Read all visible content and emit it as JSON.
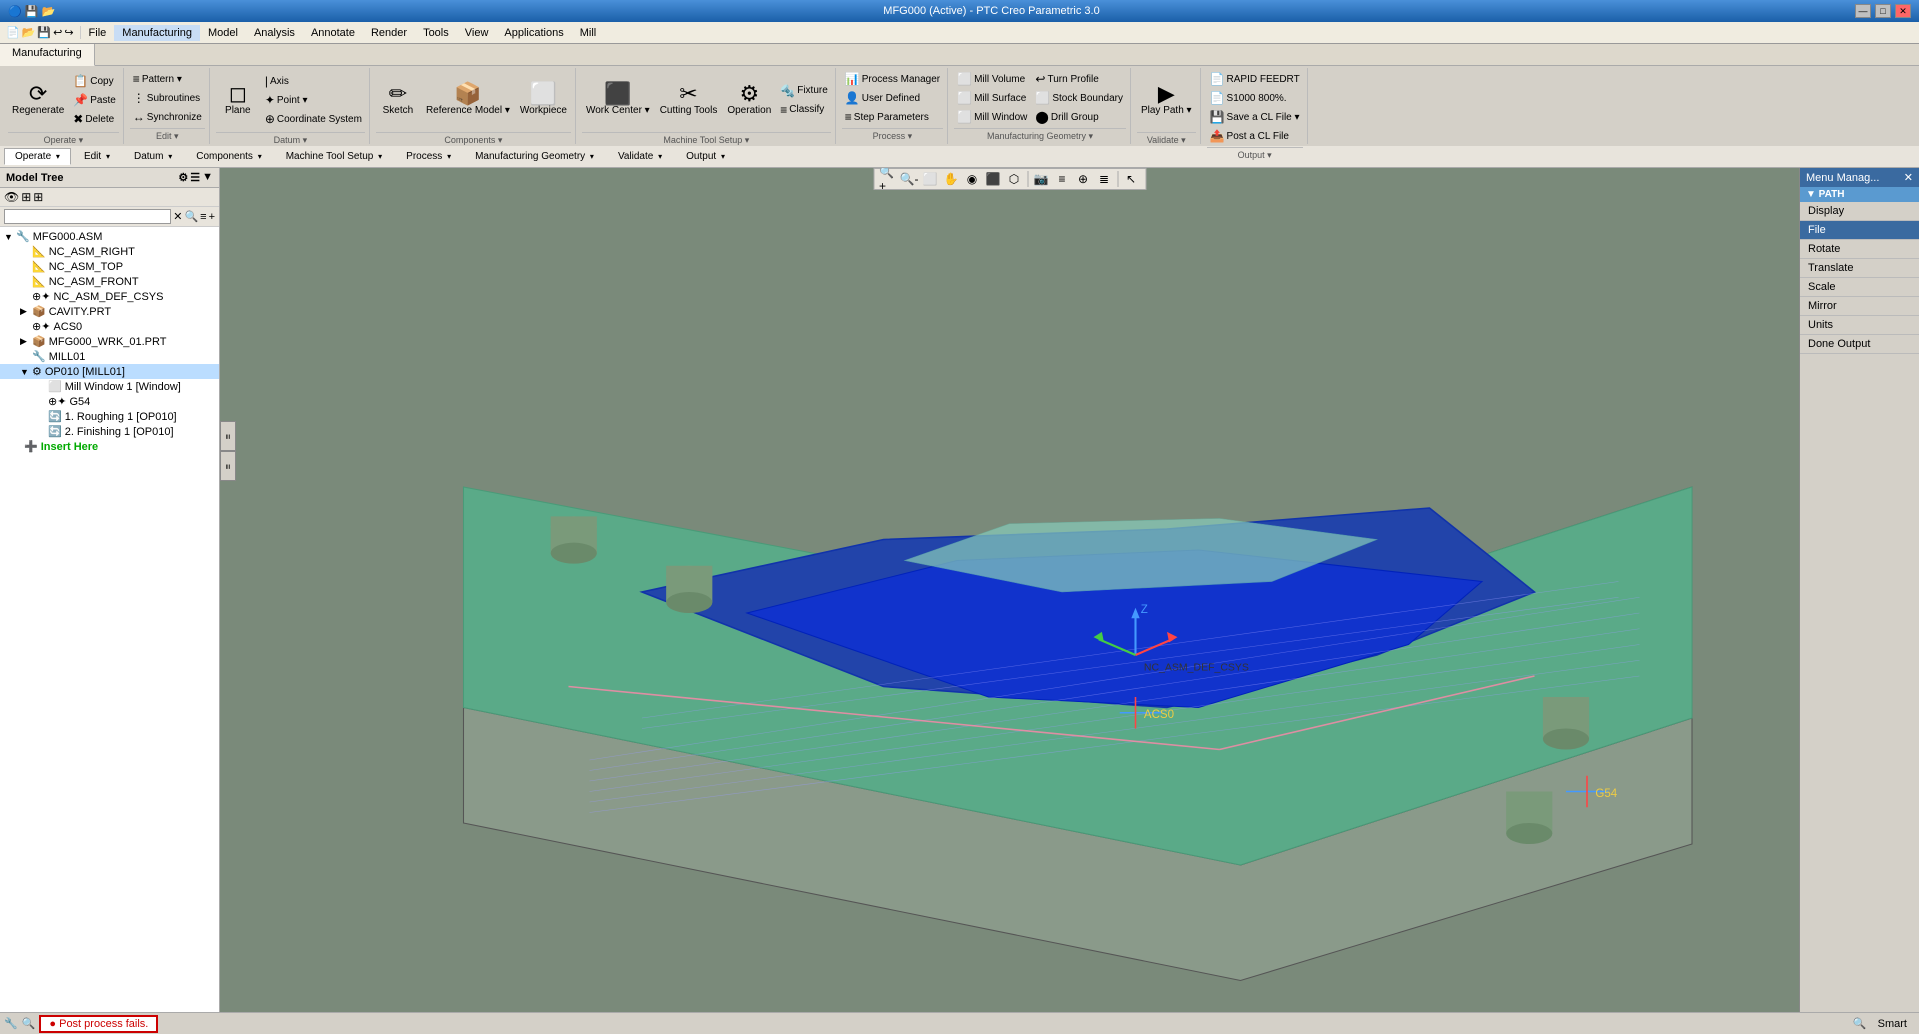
{
  "title": "MFG000 (Active) - PTC Creo Parametric 3.0",
  "titlebar": {
    "controls": [
      "—",
      "□",
      "✕"
    ]
  },
  "menubar": {
    "items": [
      "File",
      "Manufacturing",
      "Model",
      "Analysis",
      "Annotate",
      "Render",
      "Tools",
      "View",
      "Applications",
      "Mill"
    ]
  },
  "ribbon": {
    "tabs": [
      "Manufacturing"
    ],
    "groups": [
      {
        "label": "Operate",
        "buttons_large": [
          {
            "icon": "⟳",
            "label": "Regenerate"
          }
        ],
        "buttons_small": [
          {
            "icon": "📋",
            "label": "Copy"
          },
          {
            "icon": "📌",
            "label": "Paste"
          },
          {
            "icon": "🗑",
            "label": "Delete"
          }
        ]
      },
      {
        "label": "Edit",
        "buttons_small": [
          {
            "icon": "≡",
            "label": "Pattern ▾"
          },
          {
            "icon": "⋮",
            "label": "Subroutines"
          },
          {
            "icon": "≡",
            "label": "Synchronize"
          }
        ]
      },
      {
        "label": "Datum",
        "buttons_large": [
          {
            "icon": "◉",
            "label": "Plane"
          }
        ],
        "buttons_small": [
          {
            "icon": "•",
            "label": "Axis"
          },
          {
            "icon": "✦",
            "label": "Point ▾"
          },
          {
            "icon": "⊕",
            "label": "Coordinate System"
          }
        ]
      },
      {
        "label": "Components",
        "buttons_large": [
          {
            "icon": "✏",
            "label": "Sketch"
          },
          {
            "icon": "⬡",
            "label": "Reference Model ▾"
          },
          {
            "icon": "⚙",
            "label": "Workpiece"
          }
        ]
      },
      {
        "label": "Machine Tool Setup",
        "buttons_large": [
          {
            "icon": "⬜",
            "label": "Work Center ▾"
          },
          {
            "icon": "✂",
            "label": "Cutting Tools"
          },
          {
            "icon": "⚙",
            "label": "Operation"
          }
        ],
        "buttons_small": [
          {
            "icon": "🔧",
            "label": "Fixture"
          },
          {
            "icon": "≡",
            "label": "Classify"
          }
        ]
      },
      {
        "label": "Process",
        "buttons_small": [
          {
            "icon": "⚙",
            "label": "Process Manager"
          },
          {
            "icon": "👤",
            "label": "User Defined"
          },
          {
            "icon": "≡",
            "label": "Step Parameters"
          }
        ]
      },
      {
        "label": "Manufacturing Geometry",
        "buttons_small": [
          {
            "icon": "⬜",
            "label": "Mill Volume"
          },
          {
            "icon": "⬜",
            "label": "Mill Surface"
          },
          {
            "icon": "⬜",
            "label": "Mill Window"
          },
          {
            "icon": "↩",
            "label": "Turn Profile"
          },
          {
            "icon": "⬜",
            "label": "Stock Boundary"
          },
          {
            "icon": "⬤",
            "label": "Drill Group"
          }
        ]
      },
      {
        "label": "Validate",
        "buttons_small": [
          {
            "icon": "▶",
            "label": "Play Path ▾"
          }
        ]
      },
      {
        "label": "Output",
        "buttons_small": [
          {
            "icon": "📄",
            "label": "RAPID FEEDRT"
          },
          {
            "icon": "📄",
            "label": "S1000 800%."
          },
          {
            "icon": "💾",
            "label": "Save a CL File ▾"
          },
          {
            "icon": "📄",
            "label": "Post a CL File"
          }
        ]
      }
    ]
  },
  "toolbar": {
    "buttons": [
      "🔍+",
      "🔍-",
      "⬜",
      "◻",
      "◉",
      "⬛",
      "⬡",
      "📷",
      "⊕",
      "✕",
      "⟳"
    ]
  },
  "cmd_tabs": [
    {
      "label": "Operate",
      "active": false
    },
    {
      "label": "Edit",
      "active": false
    },
    {
      "label": "Datum",
      "active": false
    },
    {
      "label": "Components",
      "active": false
    },
    {
      "label": "Machine Tool Setup",
      "active": false
    },
    {
      "label": "Process",
      "active": false
    },
    {
      "label": "Manufacturing Geometry",
      "active": false
    },
    {
      "label": "Validate",
      "active": false
    },
    {
      "label": "Output",
      "active": false
    }
  ],
  "model_tree": {
    "title": "Model Tree",
    "search_placeholder": "",
    "items": [
      {
        "indent": 0,
        "expand": "",
        "icon": "🔧",
        "text": "MFG000.ASM",
        "level": 0
      },
      {
        "indent": 1,
        "expand": "",
        "icon": "📐",
        "text": "NC_ASM_RIGHT",
        "level": 1
      },
      {
        "indent": 1,
        "expand": "",
        "icon": "📐",
        "text": "NC_ASM_TOP",
        "level": 1
      },
      {
        "indent": 1,
        "expand": "",
        "icon": "📐",
        "text": "NC_ASM_FRONT",
        "level": 1
      },
      {
        "indent": 1,
        "expand": "",
        "icon": "⊕",
        "text": "NC_ASM_DEF_CSYS",
        "level": 1
      },
      {
        "indent": 1,
        "expand": "▶",
        "icon": "📦",
        "text": "CAVITY.PRT",
        "level": 1
      },
      {
        "indent": 1,
        "expand": "",
        "icon": "⊕",
        "text": "ACS0",
        "level": 1
      },
      {
        "indent": 1,
        "expand": "▶",
        "icon": "📦",
        "text": "MFG000_WRK_01.PRT",
        "level": 1
      },
      {
        "indent": 1,
        "expand": "",
        "icon": "🔧",
        "text": "MILL01",
        "level": 1
      },
      {
        "indent": 1,
        "expand": "▼",
        "icon": "⚙",
        "text": "OP010 [MILL01]",
        "level": 1
      },
      {
        "indent": 2,
        "expand": "",
        "icon": "⬜",
        "text": "Mill Window 1 [Window]",
        "level": 2
      },
      {
        "indent": 2,
        "expand": "",
        "icon": "⊕",
        "text": "G54",
        "level": 2
      },
      {
        "indent": 2,
        "expand": "",
        "icon": "🔄",
        "text": "1. Roughing 1 [OP010]",
        "level": 2
      },
      {
        "indent": 2,
        "expand": "",
        "icon": "🔄",
        "text": "2. Finishing 1 [OP010]",
        "level": 2
      },
      {
        "indent": 1,
        "expand": "",
        "icon": "➕",
        "text": "Insert Here",
        "level": 1,
        "special": "insert"
      }
    ]
  },
  "menu_manager": {
    "title": "Menu Manag...",
    "path_label": "▼ PATH",
    "items": [
      {
        "label": "Display",
        "active": false
      },
      {
        "label": "File",
        "active": true
      },
      {
        "label": "Rotate",
        "active": false
      },
      {
        "label": "Translate",
        "active": false
      },
      {
        "label": "Scale",
        "active": false
      },
      {
        "label": "Mirror",
        "active": false
      },
      {
        "label": "Units",
        "active": false
      },
      {
        "label": "Done Output",
        "active": false
      }
    ]
  },
  "status": {
    "message": "● Post process fails.",
    "right": "Smart"
  },
  "viewport": {
    "labels": [
      "NC_ASM_DEF_CSYS",
      "ACS0",
      "G54"
    ]
  }
}
